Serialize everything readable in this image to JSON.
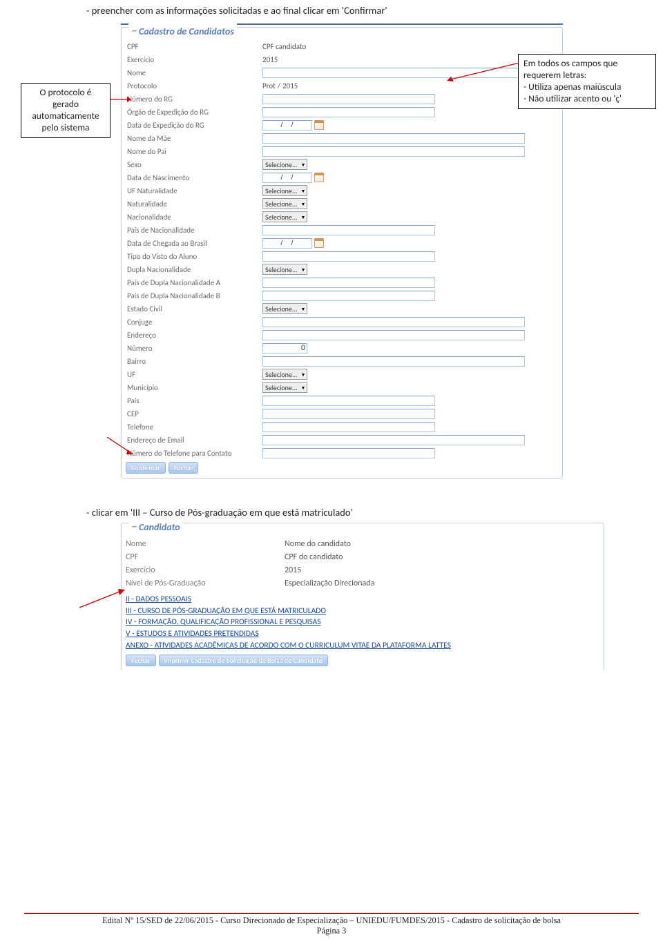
{
  "instruction1": "- preencher com as informações solicitadas e ao final clicar em 'Confirmar'",
  "callout_left": {
    "l1": "O protocolo é",
    "l2": "gerado",
    "l3": "automaticamente",
    "l4": "pelo sistema"
  },
  "callout_right": {
    "l1": "Em todos os campos que",
    "l2": "requerem letras:",
    "l3": "- Utiliza apenas maiúscula",
    "l4": "- Não utilizar acento ou 'ç'"
  },
  "cadastro": {
    "legend": "Cadastro de Candidatos",
    "labels": {
      "cpf": "CPF",
      "exercicio": "Exercício",
      "nome": "Nome",
      "protocolo": "Protocolo",
      "numero_rg": "Número do RG",
      "orgao_rg": "Órgão de Expedição do RG",
      "data_rg": "Data de Expedição do RG",
      "nome_mae": "Nome da Mãe",
      "nome_pai": "Nome do Pai",
      "sexo": "Sexo",
      "data_nasc": "Data de Nascimento",
      "uf_nat": "UF Naturalidade",
      "naturalidade": "Naturalidade",
      "nacionalidade": "Nacionalidade",
      "pais_nac": "País de Nacionalidade",
      "data_chegada": "Data de Chegada ao Brasil",
      "visto": "Tipo do Visto do Aluno",
      "dupla": "Dupla Nacionalidade",
      "pais_a": "País de Dupla Nacionalidade A",
      "pais_b": "País de Dupla Nacionalidade B",
      "estado_civil": "Estado Civil",
      "conjuge": "Conjuge",
      "endereco": "Endereço",
      "numero": "Número",
      "bairro": "Bairro",
      "uf": "UF",
      "municipio": "Município",
      "pais": "País",
      "cep": "CEP",
      "telefone": "Telefone",
      "email": "Endereço de Email",
      "tel_contato": "Número do Telefone para Contato"
    },
    "values": {
      "cpf": "CPF candidato",
      "exercicio": "2015",
      "prot_txt": "Prot",
      "prot_sep": "/",
      "prot_year": "2015",
      "select_default": "Selecione...",
      "date_ph": "/   /",
      "numero_default": "0"
    },
    "buttons": {
      "confirmar": "Confirmar",
      "fechar": "Fechar"
    }
  },
  "instruction2": "- clicar em 'III – Curso de Pós-graduação em que está matriculado'",
  "candidato": {
    "legend": "Candidato",
    "labels": {
      "nome": "Nome",
      "cpf": "CPF",
      "exercicio": "Exercício",
      "nivel": "Nível de Pós-Graduação"
    },
    "values": {
      "nome": "Nome do candidato",
      "cpf": "CPF do candidato",
      "exercicio": "2015",
      "nivel": "Especialização Direcionada"
    },
    "links": {
      "ii": "II - DADOS PESSOAIS",
      "iii": "III - CURSO DE PÓS-GRADUAÇÃO EM QUE ESTÁ MATRICULADO",
      "iv": "IV - FORMAÇÃO, QUALIFICAÇÃO PROFISSIONAL E PESQUISAS",
      "v": "V - ESTUDOS E ATIVIDADES PRETENDIDAS",
      "anexo": "ANEXO - ATIVIDADES ACADÊMICAS DE ACORDO COM O CURRICULUM VITAE DA PLATAFORMA LATTES"
    },
    "buttons": {
      "fechar": "Fechar",
      "imprimir": "Imprimir Cadastro de Solicitação de Bolsa do Candidato"
    }
  },
  "footer": {
    "line1": "Edital Nº 15/SED de 22/06/2015 - Curso Direcionado de Especialização – UNIEDU/FUMDES/2015 - Cadastro de solicitação de bolsa",
    "line2": "Página 3"
  }
}
